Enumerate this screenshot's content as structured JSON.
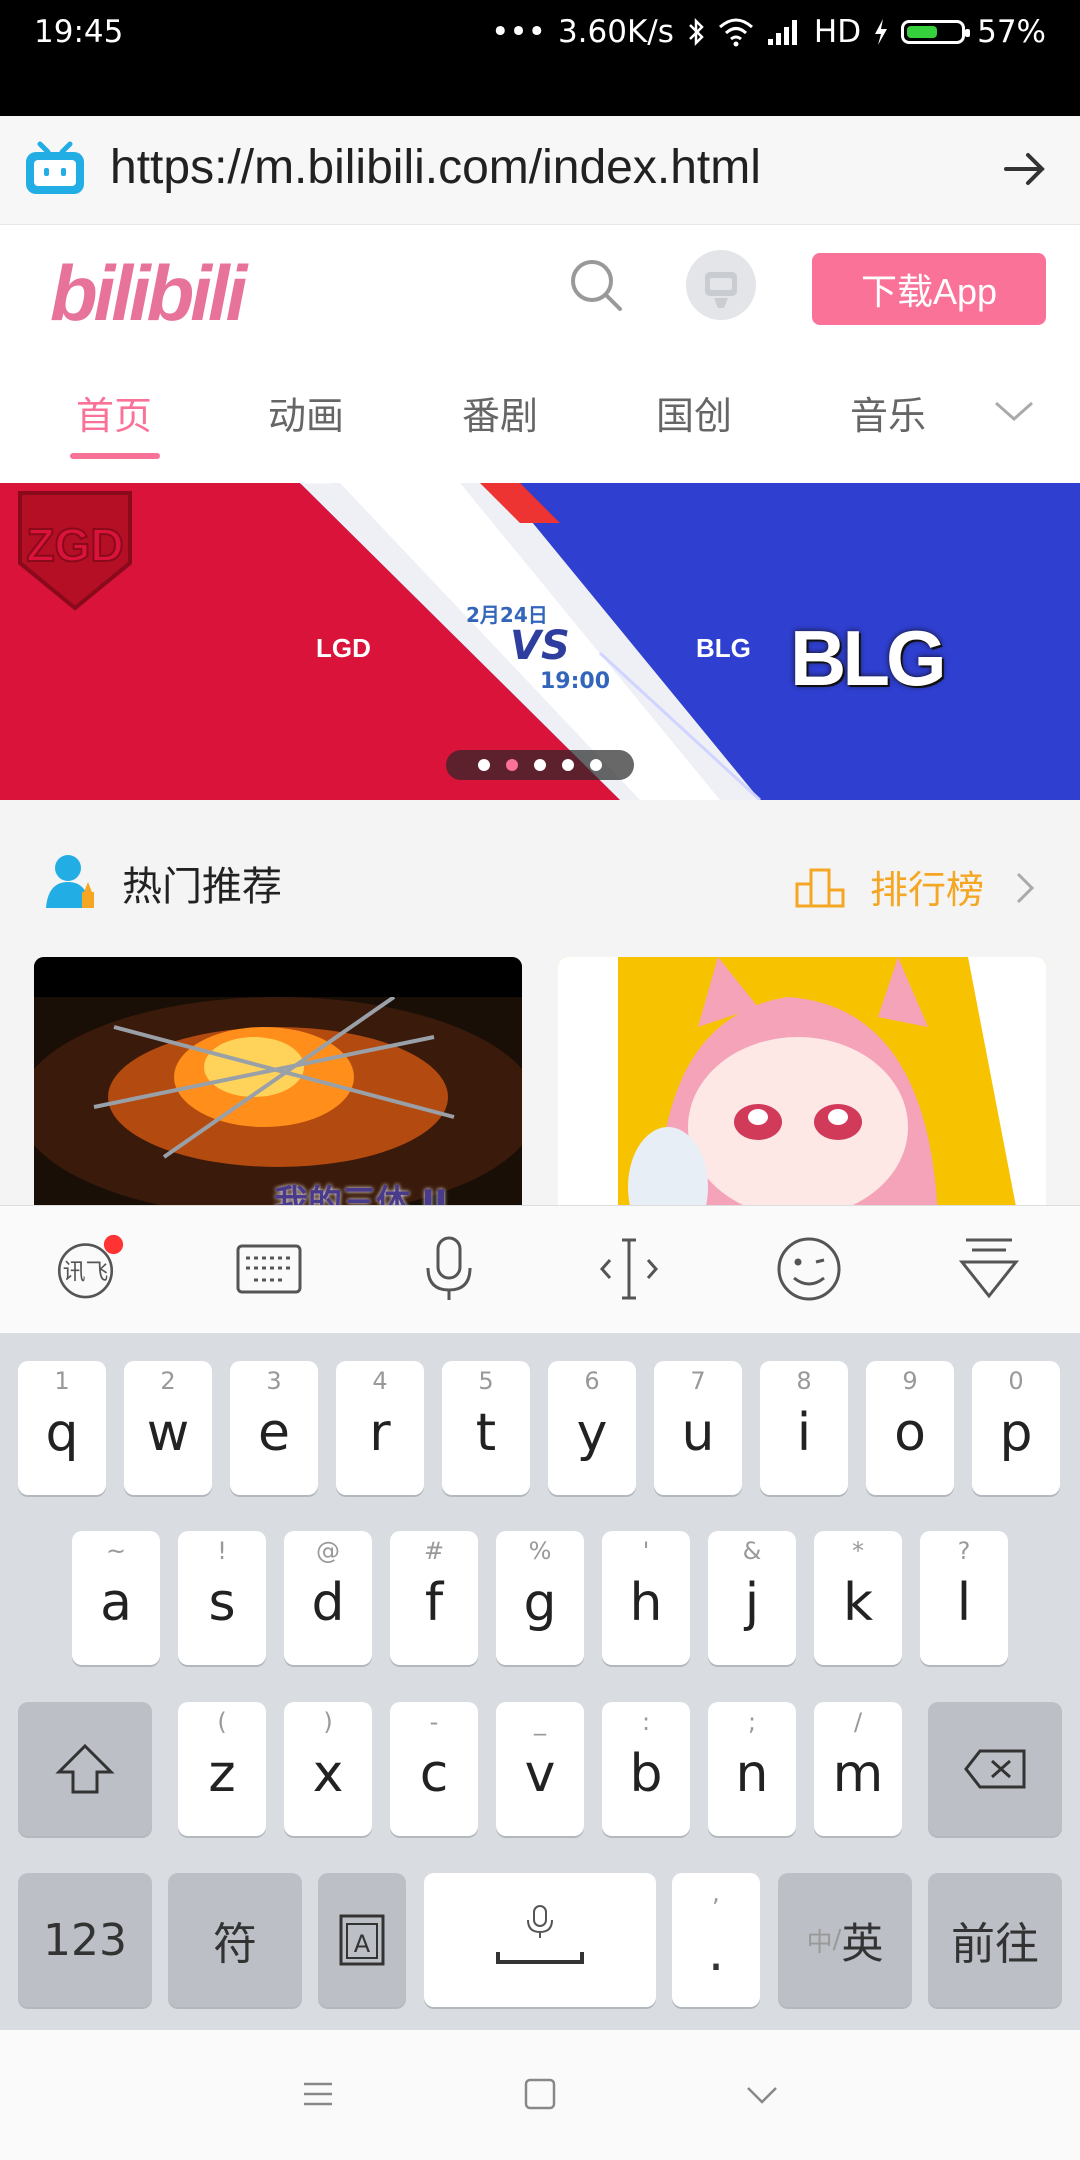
{
  "status_bar": {
    "time": "19:45",
    "signal_dots": "•••",
    "speed": "3.60K/s",
    "network": "HD",
    "battery": "57%",
    "battery_level": 0.57,
    "icons": [
      "bluetooth-icon",
      "wifi-icon",
      "signal-icon",
      "charging-icon",
      "battery-icon"
    ]
  },
  "browser": {
    "url": "https://m.bilibili.com/index.html",
    "go_icon": "arrow-right-icon"
  },
  "header": {
    "logo": "bilibili",
    "download_label": "下载App",
    "accent": "#fb7299"
  },
  "nav": {
    "tabs": [
      "首页",
      "动画",
      "番剧",
      "国创",
      "音乐"
    ],
    "active_index": 0
  },
  "banner": {
    "team_left": "LGD",
    "team_right": "BLG",
    "date": "2月24日",
    "vs": "VS",
    "time": "19:00",
    "slides": 5,
    "active_slide": 2
  },
  "hot": {
    "title": "热门推荐",
    "ranking_label": "排行榜",
    "card_1_caption": "我的三体 II"
  },
  "keyboard": {
    "toolbar_icons": [
      "xunfei-icon",
      "keyboard-icon",
      "microphone-icon",
      "cursor-icon",
      "emoji-icon",
      "collapse-keyboard-icon"
    ],
    "row1": [
      {
        "k": "q",
        "s": "1"
      },
      {
        "k": "w",
        "s": "2"
      },
      {
        "k": "e",
        "s": "3"
      },
      {
        "k": "r",
        "s": "4"
      },
      {
        "k": "t",
        "s": "5"
      },
      {
        "k": "y",
        "s": "6"
      },
      {
        "k": "u",
        "s": "7"
      },
      {
        "k": "i",
        "s": "8"
      },
      {
        "k": "o",
        "s": "9"
      },
      {
        "k": "p",
        "s": "0"
      }
    ],
    "row2": [
      {
        "k": "a",
        "s": "~"
      },
      {
        "k": "s",
        "s": "!"
      },
      {
        "k": "d",
        "s": "@"
      },
      {
        "k": "f",
        "s": "#"
      },
      {
        "k": "g",
        "s": "%"
      },
      {
        "k": "h",
        "s": "'"
      },
      {
        "k": "j",
        "s": "&"
      },
      {
        "k": "k",
        "s": "*"
      },
      {
        "k": "l",
        "s": "?"
      }
    ],
    "row3": [
      {
        "k": "z",
        "s": "("
      },
      {
        "k": "x",
        "s": ")"
      },
      {
        "k": "c",
        "s": "-"
      },
      {
        "k": "v",
        "s": "_"
      },
      {
        "k": "b",
        "s": ":"
      },
      {
        "k": "n",
        "s": ";"
      },
      {
        "k": "m",
        "s": "/"
      }
    ],
    "num_label": "123",
    "symbol_label": "符",
    "period_label": ".",
    "period_sub": ",",
    "lang_inactive": "中",
    "lang_sep": "/",
    "lang_active": "英",
    "go_label": "前往"
  },
  "system_nav": {
    "icons": [
      "menu-icon",
      "home-icon",
      "back-icon"
    ]
  }
}
